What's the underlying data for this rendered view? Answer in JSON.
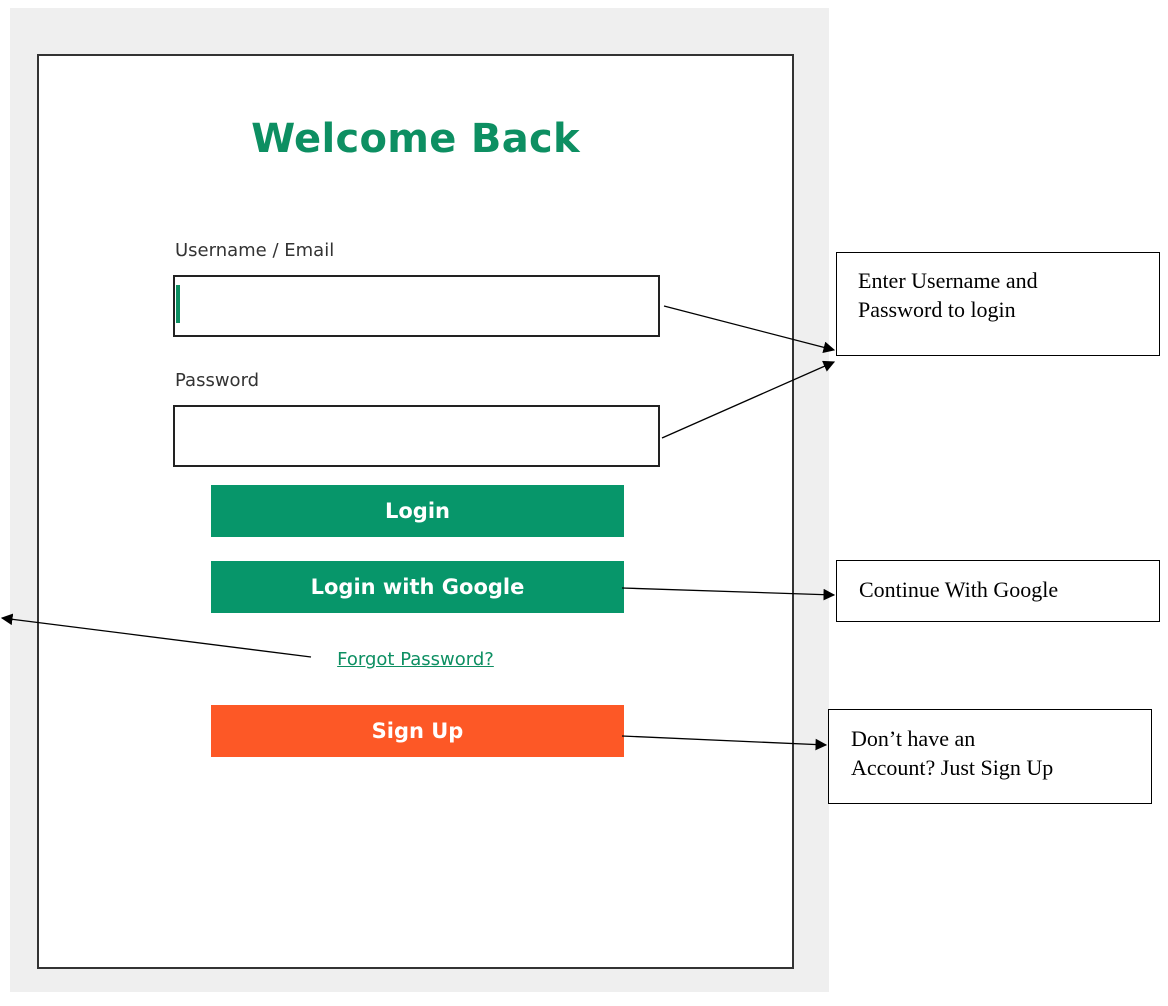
{
  "login": {
    "title": "Welcome Back",
    "username_label": "Username / Email",
    "username_value": "",
    "password_label": "Password",
    "password_value": "",
    "login_button": "Login",
    "google_button": "Login with Google",
    "forgot_link": "Forgot Password?",
    "signup_button": "Sign Up"
  },
  "annotations": {
    "credentials_line1": "Enter Username and",
    "credentials_line2": "Password to login",
    "google": "Continue With Google",
    "signup_line1": "Don’t have an",
    "signup_line2": "Account? Just Sign Up"
  },
  "colors": {
    "brand_green": "#07966a",
    "signup_orange": "#fd5826",
    "panel_background": "#efefef"
  }
}
